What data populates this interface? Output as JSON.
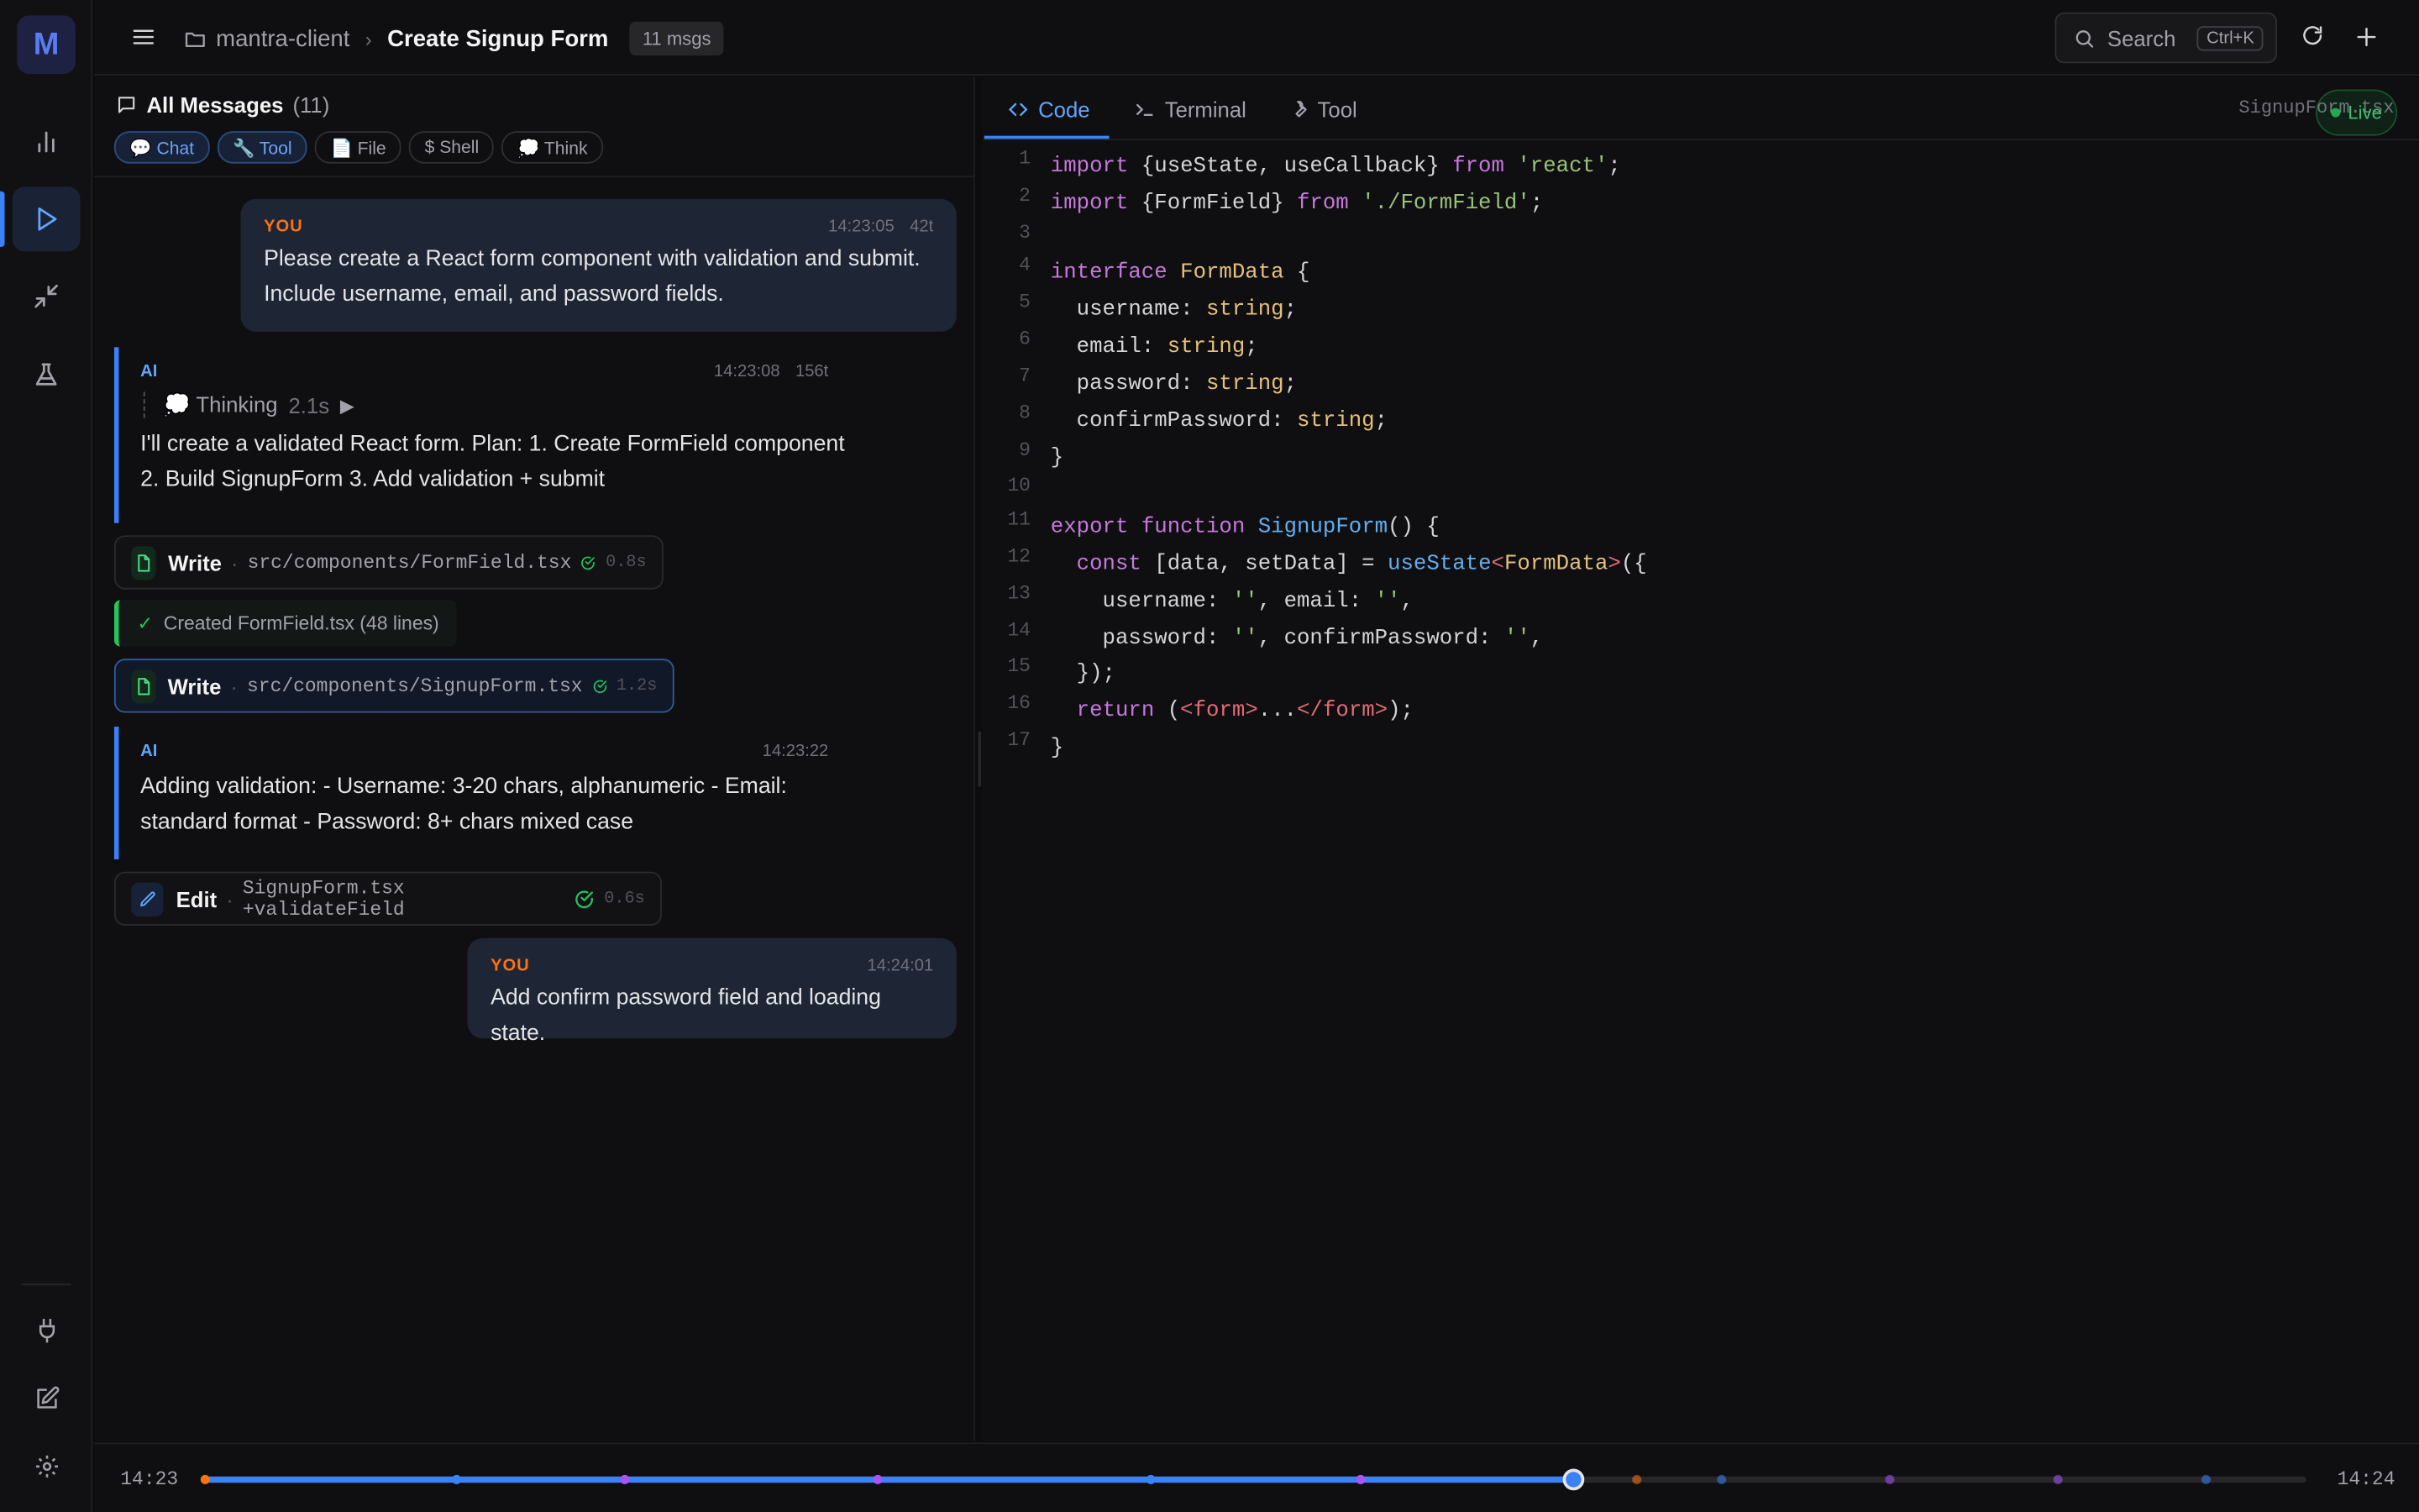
{
  "app": {
    "logo_letter": "M"
  },
  "header": {
    "project": "mantra-client",
    "title": "Create Signup Form",
    "msg_count": "11 msgs",
    "search_label": "Search",
    "search_shortcut": "Ctrl+K"
  },
  "messages_panel": {
    "title": "All Messages",
    "count": "(11)",
    "filters": [
      "💬 Chat",
      "🔧 Tool",
      "📄 File",
      "$ Shell",
      "💭 Think"
    ],
    "active_filters": [
      "Chat",
      "Tool"
    ]
  },
  "messages": {
    "m1": {
      "role": "YOU",
      "time": "14:23:05",
      "tokens": "42t",
      "text": "Please create a React form component with validation and submit. Include username, email, and password fields."
    },
    "m2": {
      "role": "AI",
      "time": "14:23:08",
      "tokens": "156t",
      "thinking_label": "💭 Thinking",
      "thinking_duration": "2.1s",
      "text": "I'll create a validated React form. Plan: 1. Create FormField component 2. Build SignupForm 3. Add validation + submit"
    },
    "t1": {
      "tool": "Write",
      "path": "src/components/FormField.tsx",
      "duration": "0.8s"
    },
    "r1": {
      "text": "Created FormField.tsx (48 lines)"
    },
    "t2": {
      "tool": "Write",
      "path": "src/components/SignupForm.tsx",
      "duration": "1.2s"
    },
    "m3": {
      "role": "AI",
      "time": "14:23:22",
      "text": "Adding validation: - Username: 3-20 chars, alphanumeric - Email: standard format - Password: 8+ chars mixed case"
    },
    "t3": {
      "tool": "Edit",
      "path": "SignupForm.tsx +validateField",
      "duration": "0.6s"
    },
    "m4": {
      "role": "YOU",
      "time": "14:24:01",
      "text": "Add confirm password field and loading state."
    }
  },
  "editor": {
    "tabs": [
      "Code",
      "Terminal",
      "Tool"
    ],
    "active_tab": "Code",
    "filename": "SignupForm.tsx",
    "live_label": "Live",
    "lines": [
      [
        [
          "k",
          "import"
        ],
        [
          "p",
          " {useState, useCallback} "
        ],
        [
          "k",
          "from"
        ],
        [
          "p",
          " "
        ],
        [
          "s",
          "'react'"
        ],
        [
          "p",
          ";"
        ]
      ],
      [
        [
          "k",
          "import"
        ],
        [
          "p",
          " {FormField} "
        ],
        [
          "k",
          "from"
        ],
        [
          "p",
          " "
        ],
        [
          "s",
          "'./FormField'"
        ],
        [
          "p",
          ";"
        ]
      ],
      [],
      [
        [
          "k",
          "interface"
        ],
        [
          "p",
          " "
        ],
        [
          "t",
          "FormData"
        ],
        [
          "p",
          " {"
        ]
      ],
      [
        [
          "p",
          "  username: "
        ],
        [
          "t",
          "string"
        ],
        [
          "p",
          ";"
        ]
      ],
      [
        [
          "p",
          "  email: "
        ],
        [
          "t",
          "string"
        ],
        [
          "p",
          ";"
        ]
      ],
      [
        [
          "p",
          "  password: "
        ],
        [
          "t",
          "string"
        ],
        [
          "p",
          ";"
        ]
      ],
      [
        [
          "p",
          "  confirmPassword: "
        ],
        [
          "t",
          "string"
        ],
        [
          "p",
          ";"
        ]
      ],
      [
        [
          "p",
          "}"
        ]
      ],
      [],
      [
        [
          "k",
          "export"
        ],
        [
          "p",
          " "
        ],
        [
          "k",
          "function"
        ],
        [
          "p",
          " "
        ],
        [
          "f",
          "SignupForm"
        ],
        [
          "p",
          "() {"
        ]
      ],
      [
        [
          "p",
          "  "
        ],
        [
          "k",
          "const"
        ],
        [
          "p",
          " [data, setData] = "
        ],
        [
          "f",
          "useState"
        ],
        [
          "tag",
          "<"
        ],
        [
          "t",
          "FormData"
        ],
        [
          "tag",
          ">"
        ],
        [
          "p",
          "({"
        ]
      ],
      [
        [
          "p",
          "    username: "
        ],
        [
          "s",
          "''"
        ],
        [
          "p",
          ", email: "
        ],
        [
          "s",
          "''"
        ],
        [
          "p",
          ","
        ]
      ],
      [
        [
          "p",
          "    password: "
        ],
        [
          "s",
          "''"
        ],
        [
          "p",
          ", confirmPassword: "
        ],
        [
          "s",
          "''"
        ],
        [
          "p",
          ","
        ]
      ],
      [
        [
          "p",
          "  });"
        ]
      ],
      [
        [
          "p",
          "  "
        ],
        [
          "k",
          "return"
        ],
        [
          "p",
          " ("
        ],
        [
          "tag",
          "<form>"
        ],
        [
          "p",
          "..."
        ],
        [
          "tag",
          "</form>"
        ],
        [
          "p",
          ");"
        ]
      ],
      [
        [
          "p",
          "}"
        ]
      ]
    ]
  },
  "timeline": {
    "start": "14:23",
    "end": "14:24",
    "progress": 0.651,
    "events": [
      {
        "pos": 0.0,
        "kind": "user"
      },
      {
        "pos": 0.12,
        "kind": "ai"
      },
      {
        "pos": 0.2,
        "kind": "tool"
      },
      {
        "pos": 0.32,
        "kind": "tool"
      },
      {
        "pos": 0.45,
        "kind": "ai"
      },
      {
        "pos": 0.55,
        "kind": "tool"
      },
      {
        "pos": 0.681,
        "kind": "user"
      },
      {
        "pos": 0.722,
        "kind": "ai"
      },
      {
        "pos": 0.802,
        "kind": "tool"
      },
      {
        "pos": 0.882,
        "kind": "tool"
      },
      {
        "pos": 0.952,
        "kind": "ai"
      }
    ],
    "colors": {
      "user": "#f97316",
      "ai": "#3b82f6",
      "tool": "#a855f7"
    }
  }
}
